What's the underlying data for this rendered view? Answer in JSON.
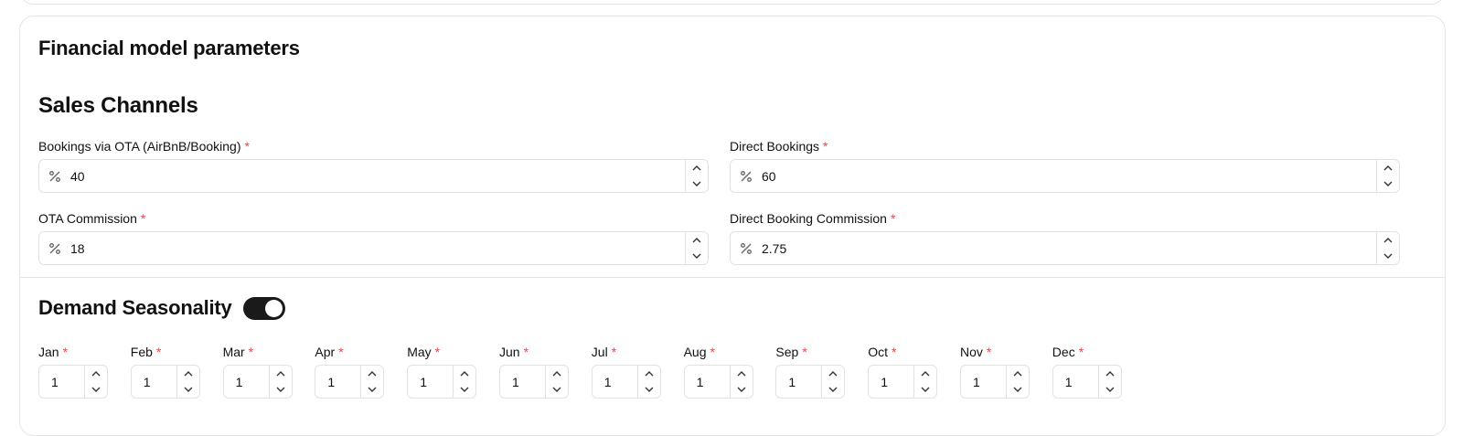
{
  "card": {
    "title": "Financial model parameters"
  },
  "sales_channels": {
    "title": "Sales Channels",
    "required_mark": "*",
    "fields": [
      {
        "label": "Bookings via OTA (AirBnB/Booking)",
        "value": "40",
        "prefix_icon": "percent-icon"
      },
      {
        "label": "Direct Bookings",
        "value": "60",
        "prefix_icon": "percent-icon"
      },
      {
        "label": "OTA Commission",
        "value": "18",
        "prefix_icon": "percent-icon"
      },
      {
        "label": "Direct Booking Commission",
        "value": "2.75",
        "prefix_icon": "percent-icon"
      }
    ]
  },
  "seasonality": {
    "title": "Demand Seasonality",
    "enabled": true,
    "required_mark": "*",
    "months": [
      {
        "label": "Jan",
        "value": "1"
      },
      {
        "label": "Feb",
        "value": "1"
      },
      {
        "label": "Mar",
        "value": "1"
      },
      {
        "label": "Apr",
        "value": "1"
      },
      {
        "label": "May",
        "value": "1"
      },
      {
        "label": "Jun",
        "value": "1"
      },
      {
        "label": "Jul",
        "value": "1"
      },
      {
        "label": "Aug",
        "value": "1"
      },
      {
        "label": "Sep",
        "value": "1"
      },
      {
        "label": "Oct",
        "value": "1"
      },
      {
        "label": "Nov",
        "value": "1"
      },
      {
        "label": "Dec",
        "value": "1"
      }
    ]
  },
  "colors": {
    "required": "#e5484d",
    "toggle_on": "#1a1a1a",
    "border": "#e2e2e2"
  }
}
